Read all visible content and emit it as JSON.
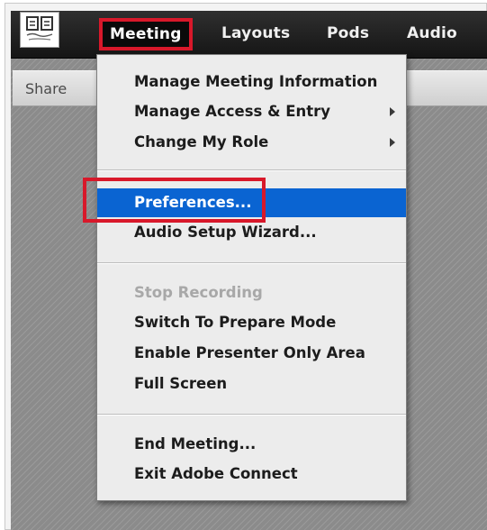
{
  "menubar": {
    "logo_icon": "university-logo-icon",
    "items": [
      {
        "label": "Meeting",
        "active": true
      },
      {
        "label": "Layouts",
        "active": false
      },
      {
        "label": "Pods",
        "active": false
      },
      {
        "label": "Audio",
        "active": false
      }
    ]
  },
  "pod": {
    "title": "Share"
  },
  "dropdown": {
    "items": [
      {
        "label": "Manage Meeting Information",
        "state": "normal",
        "submenu": false
      },
      {
        "label": "Manage Access & Entry",
        "state": "normal",
        "submenu": true
      },
      {
        "label": "Change My Role",
        "state": "normal",
        "submenu": true
      },
      {
        "label": "Preferences...",
        "state": "selected",
        "submenu": false
      },
      {
        "label": "Audio Setup Wizard...",
        "state": "normal",
        "submenu": false
      },
      {
        "label": "Stop Recording",
        "state": "disabled",
        "submenu": false
      },
      {
        "label": "Switch To Prepare Mode",
        "state": "normal",
        "submenu": false
      },
      {
        "label": "Enable Presenter Only Area",
        "state": "normal",
        "submenu": false
      },
      {
        "label": "Full Screen",
        "state": "normal",
        "submenu": false
      },
      {
        "label": "End Meeting...",
        "state": "normal",
        "submenu": false
      },
      {
        "label": "Exit Adobe Connect",
        "state": "normal",
        "submenu": false
      }
    ]
  },
  "colors": {
    "selection": "#0a64d2",
    "highlight_outline": "#d8182a",
    "menubar": "#1e1e1e"
  }
}
